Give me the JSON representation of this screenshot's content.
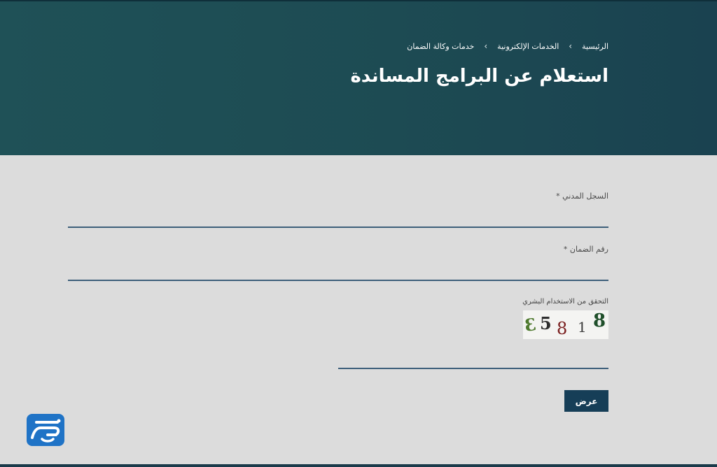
{
  "breadcrumb": {
    "items": [
      "الرئيسية",
      "الخدمات الإلكترونية",
      "خدمات وكالة الضمان"
    ],
    "separator": "›"
  },
  "page": {
    "title": "استعلام عن البرامج المساندة"
  },
  "form": {
    "civil_registry_label": "السجل المدني *",
    "civil_registry_value": "",
    "guarantee_number_label": "رقم الضمان *",
    "guarantee_number_value": "",
    "captcha_label": "التحقق من الاستخدام البشري",
    "captcha_digits": [
      "3",
      "5",
      "8",
      "1",
      "8"
    ],
    "captcha_value": "",
    "submit_label": "عرض"
  },
  "colors": {
    "header_bg": "#1f5157",
    "button_bg": "#163e57",
    "input_underline": "#3d5f7a",
    "logo_bg": "#1f73c6"
  },
  "icons": {
    "breadcrumb_separator": "chevron-left-icon",
    "logo": "site-logo-icon"
  }
}
